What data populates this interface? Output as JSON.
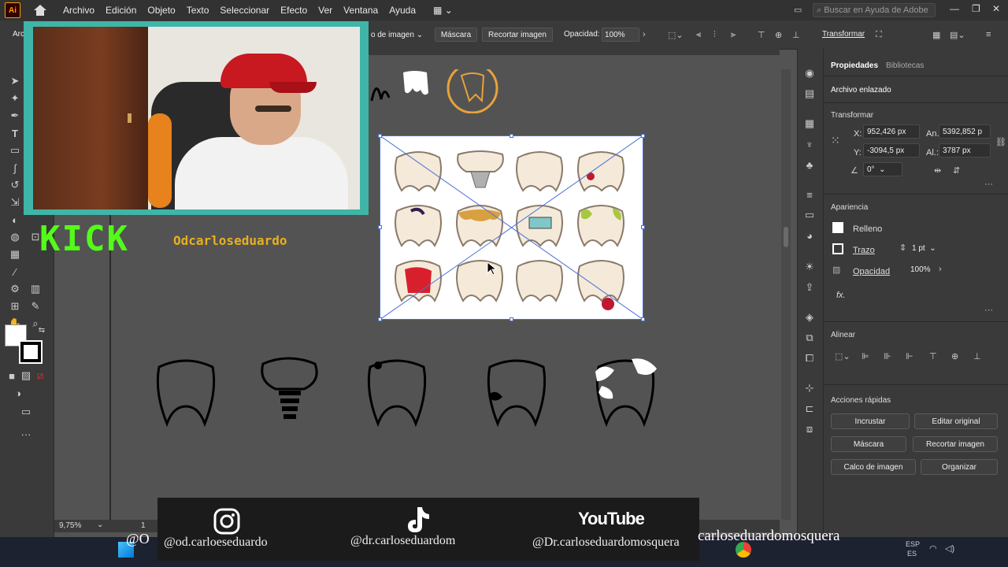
{
  "app": {
    "logo": "Ai"
  },
  "menu": [
    "Archivo",
    "Edición",
    "Objeto",
    "Texto",
    "Seleccionar",
    "Efecto",
    "Ver",
    "Ventana",
    "Ayuda"
  ],
  "search": {
    "placeholder": "Buscar en Ayuda de Adobe"
  },
  "controlbar": {
    "left_label": "Arc",
    "calco_label": "o de imagen",
    "mascara": "Máscara",
    "recortar": "Recortar imagen",
    "opacidad_label": "Opacidad:",
    "opacidad_value": "100%",
    "transformar": "Transformar"
  },
  "panel": {
    "tabs": [
      "Propiedades",
      "Bibliotecas"
    ],
    "archivo_enlazado": "Archivo enlazado",
    "transform": {
      "title": "Transformar",
      "x_label": "X:",
      "x": "952,426 px",
      "y_label": "Y:",
      "y": "-3094,5 px",
      "an_label": "An.:",
      "an": "5392,852 p",
      "al_label": "Al.:",
      "al": "3787 px",
      "angle": "0°"
    },
    "appearance": {
      "title": "Apariencia",
      "relleno": "Relleno",
      "trazo": "Trazo",
      "trazo_value": "1 pt",
      "opacidad": "Opacidad",
      "opacidad_value": "100%",
      "fx": "fx."
    },
    "align": {
      "title": "Alinear"
    },
    "quick": {
      "title": "Acciones rápidas",
      "buttons": [
        "Incrustar",
        "Editar original",
        "Máscara",
        "Recortar imagen",
        "Calco de imagen",
        "Organizar"
      ]
    }
  },
  "status": {
    "zoom": "9,75%",
    "page": "1"
  },
  "overlay": {
    "kick": "KICK",
    "kick_handle": "Odcarloseduardo",
    "instagram": "@od.carloeseduardo",
    "tiktok": "@dr.carloseduardom",
    "youtube_logo": "YouTube",
    "youtube": "@Dr.carloseduardomosquera",
    "youtube_cont": "carloseduardomosquera",
    "left_cut": "@O"
  },
  "taskbar": {
    "lang": "ESP",
    "lang2": "ES"
  },
  "colors": {
    "accent": "#ff9a00",
    "webcam_border": "#3fb5a7",
    "kick_green": "#53fc18",
    "selection": "#4a70d8"
  }
}
